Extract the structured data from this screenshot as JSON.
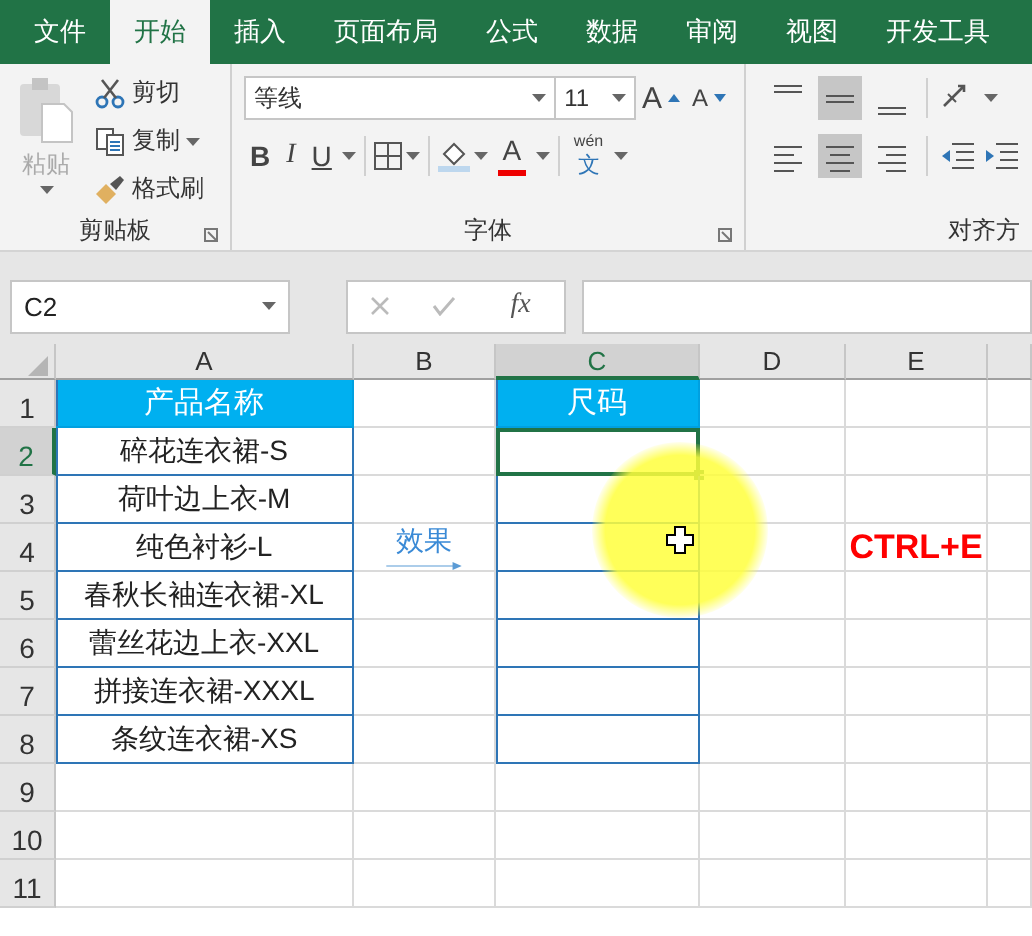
{
  "tabs": [
    {
      "label": "文件",
      "selected": false
    },
    {
      "label": "开始",
      "selected": true
    },
    {
      "label": "插入",
      "selected": false
    },
    {
      "label": "页面布局",
      "selected": false
    },
    {
      "label": "公式",
      "selected": false
    },
    {
      "label": "数据",
      "selected": false
    },
    {
      "label": "审阅",
      "selected": false
    },
    {
      "label": "视图",
      "selected": false
    },
    {
      "label": "开发工具",
      "selected": false
    }
  ],
  "ribbon": {
    "clipboard": {
      "paste": {
        "label": "粘贴",
        "disabled": true
      },
      "cut": "剪切",
      "copy": "复制",
      "format_painter": "格式刷",
      "label": "剪贴板"
    },
    "font": {
      "font_name": "等线",
      "font_size": "11",
      "grow_font": "A",
      "shrink_font": "A",
      "bold": "B",
      "italic": "I",
      "underline": "U",
      "font_color": "A",
      "phonetic_top": "wén",
      "phonetic_bottom": "文",
      "label": "字体"
    },
    "alignment": {
      "label": "对齐方",
      "buttons": [
        {
          "kind": "top",
          "selected": false
        },
        {
          "kind": "middle",
          "selected": true
        },
        {
          "kind": "bottom",
          "selected": false
        },
        {
          "kind": "left",
          "selected": false
        },
        {
          "kind": "center",
          "selected": true
        },
        {
          "kind": "right",
          "selected": false
        }
      ]
    }
  },
  "name_box": "C2",
  "formula_bar": {
    "fx": "fx"
  },
  "sheet": {
    "column_headers": [
      {
        "label": "A",
        "selected": false
      },
      {
        "label": "B",
        "selected": false
      },
      {
        "label": "C",
        "selected": true
      },
      {
        "label": "D",
        "selected": false
      },
      {
        "label": "E",
        "selected": false
      }
    ],
    "row_headers": [
      {
        "label": "1",
        "selected": false
      },
      {
        "label": "2",
        "selected": true
      },
      {
        "label": "3",
        "selected": false
      },
      {
        "label": "4",
        "selected": false
      },
      {
        "label": "5",
        "selected": false
      },
      {
        "label": "6",
        "selected": false
      },
      {
        "label": "7",
        "selected": false
      },
      {
        "label": "8",
        "selected": false
      },
      {
        "label": "9",
        "selected": false
      },
      {
        "label": "10",
        "selected": false
      },
      {
        "label": "11",
        "selected": false
      }
    ],
    "product_table": {
      "header": "产品名称",
      "rows": [
        "碎花连衣裙-S",
        "荷叶边上衣-M",
        "纯色衬衫-L",
        "春秋长袖连衣裙-XL",
        "蕾丝花边上衣-XXL",
        "拼接连衣裙-XXXL",
        "条纹连衣裙-XS"
      ]
    },
    "size_table": {
      "header": "尺码",
      "cells": [
        {
          "selected": true
        },
        {
          "selected": false
        },
        {
          "selected": false
        },
        {
          "selected": false
        },
        {
          "selected": false
        },
        {
          "selected": false
        },
        {
          "selected": false
        }
      ]
    },
    "arrow_label": "效果",
    "shortcut_note": "CTRL+E"
  }
}
